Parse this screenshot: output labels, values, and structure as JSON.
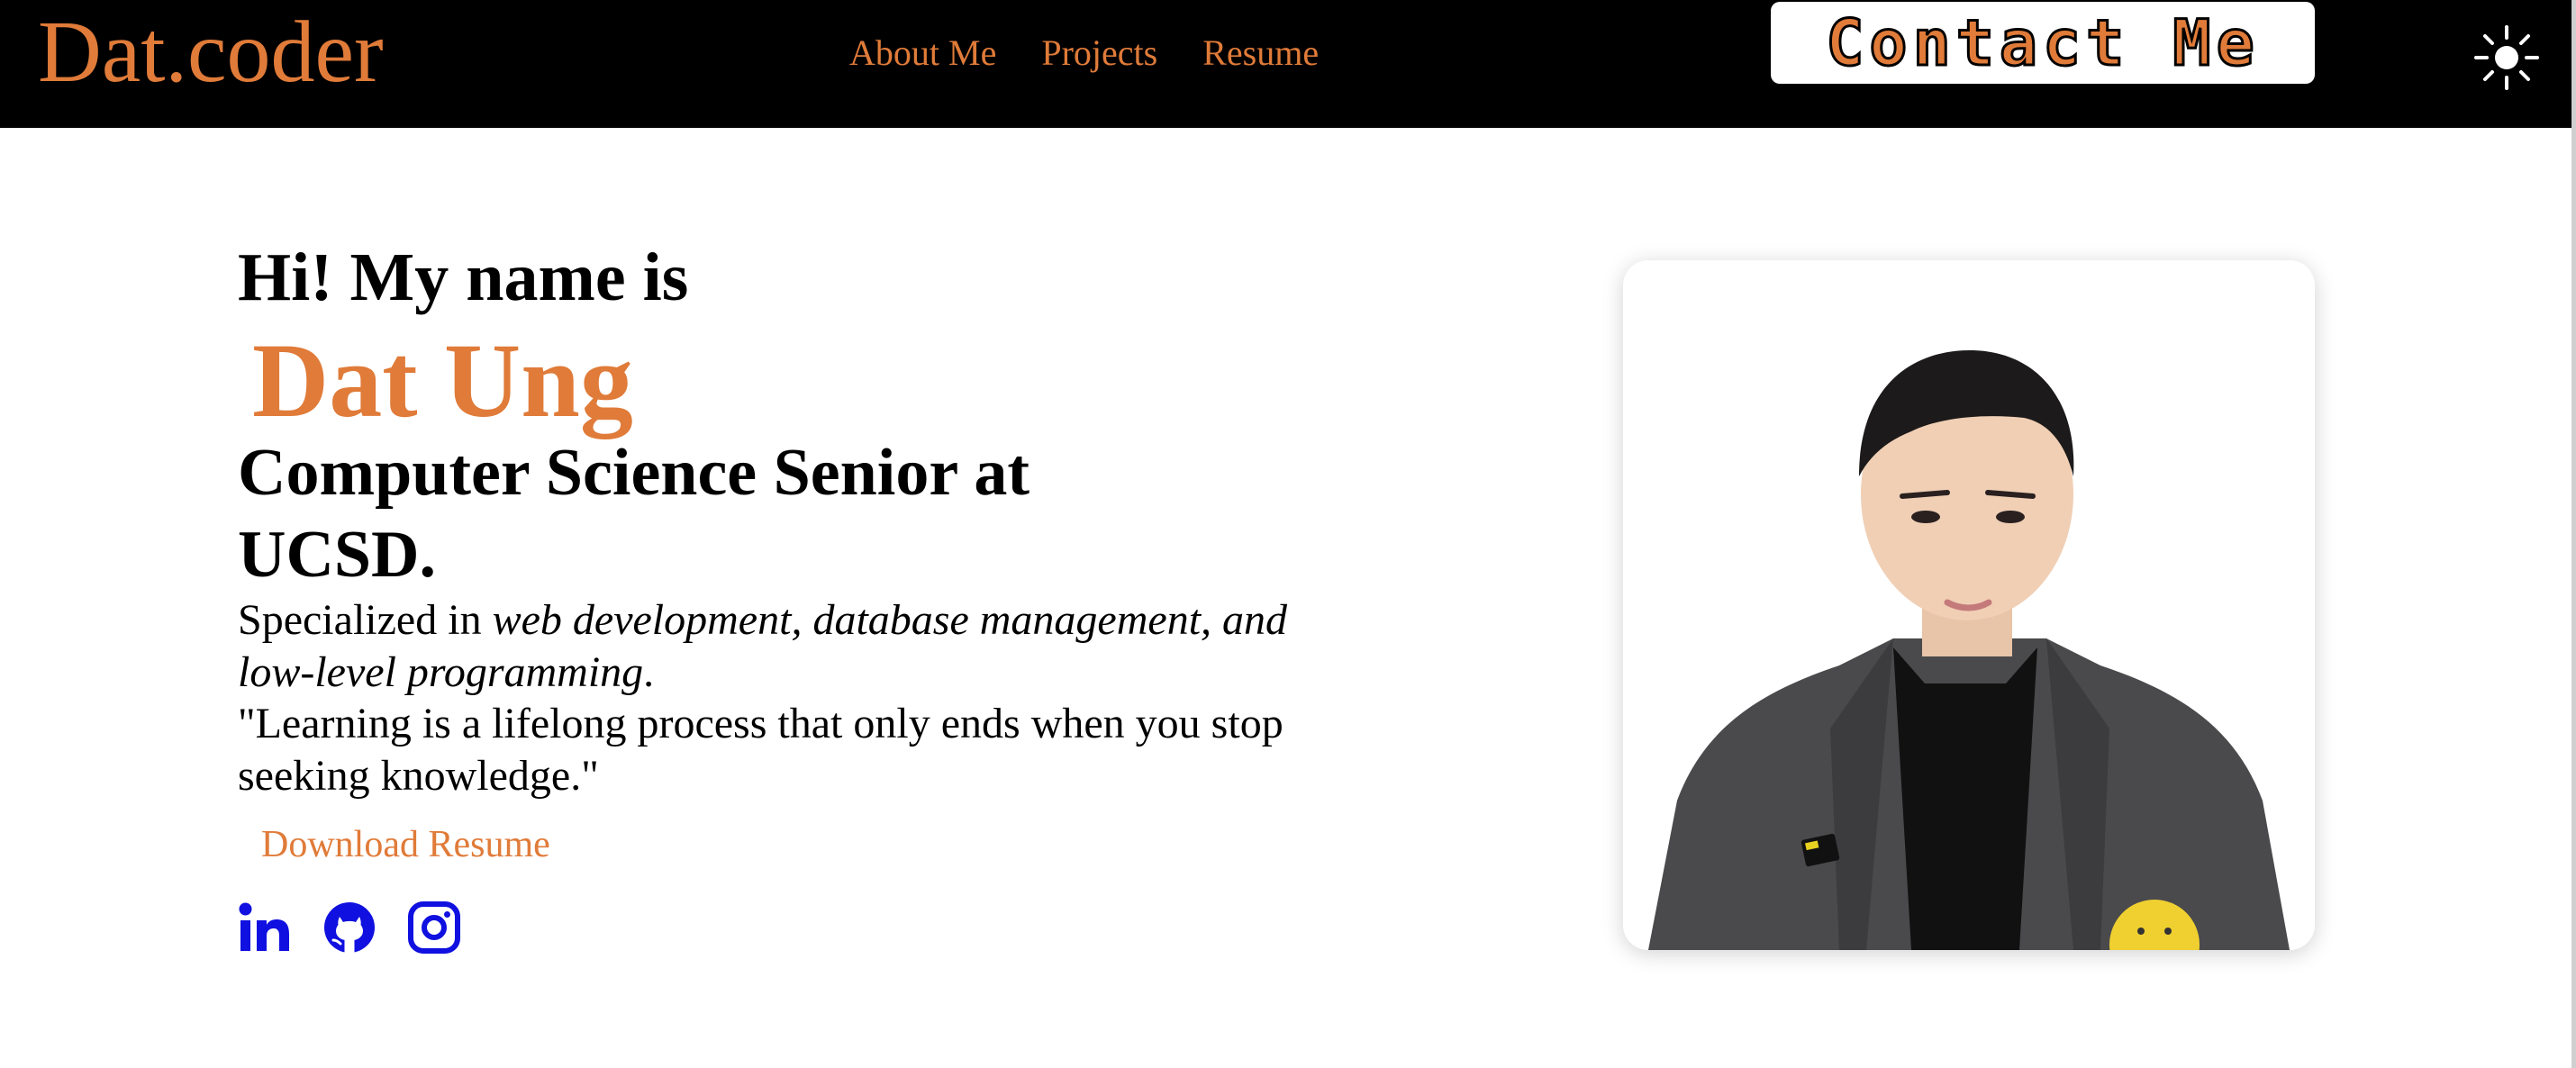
{
  "nav": {
    "brand": "Dat.coder",
    "links": [
      "About Me",
      "Projects",
      "Resume"
    ],
    "contact_label": "Contact Me",
    "theme_icon": "sun-icon"
  },
  "hero": {
    "greeting": "Hi! My name is",
    "name": "Dat Ung",
    "role": "Computer Science Senior at UCSD.",
    "summary_prefix": "Specialized in ",
    "summary_emphasis": "web development, database management, and low-level programming",
    "summary_suffix": ".",
    "quote": "\"Learning is a lifelong process that only ends when you stop seeking knowledge.\"",
    "download_label": "Download Resume"
  },
  "socials": {
    "icons": [
      "linkedin-icon",
      "github-icon",
      "instagram-icon"
    ]
  },
  "portrait": {
    "icon": "portrait-photo"
  },
  "colors": {
    "accent": "#e07b39",
    "nav_background": "#000000",
    "social_icons": "#1010e0",
    "page_background": "#ffffff"
  }
}
